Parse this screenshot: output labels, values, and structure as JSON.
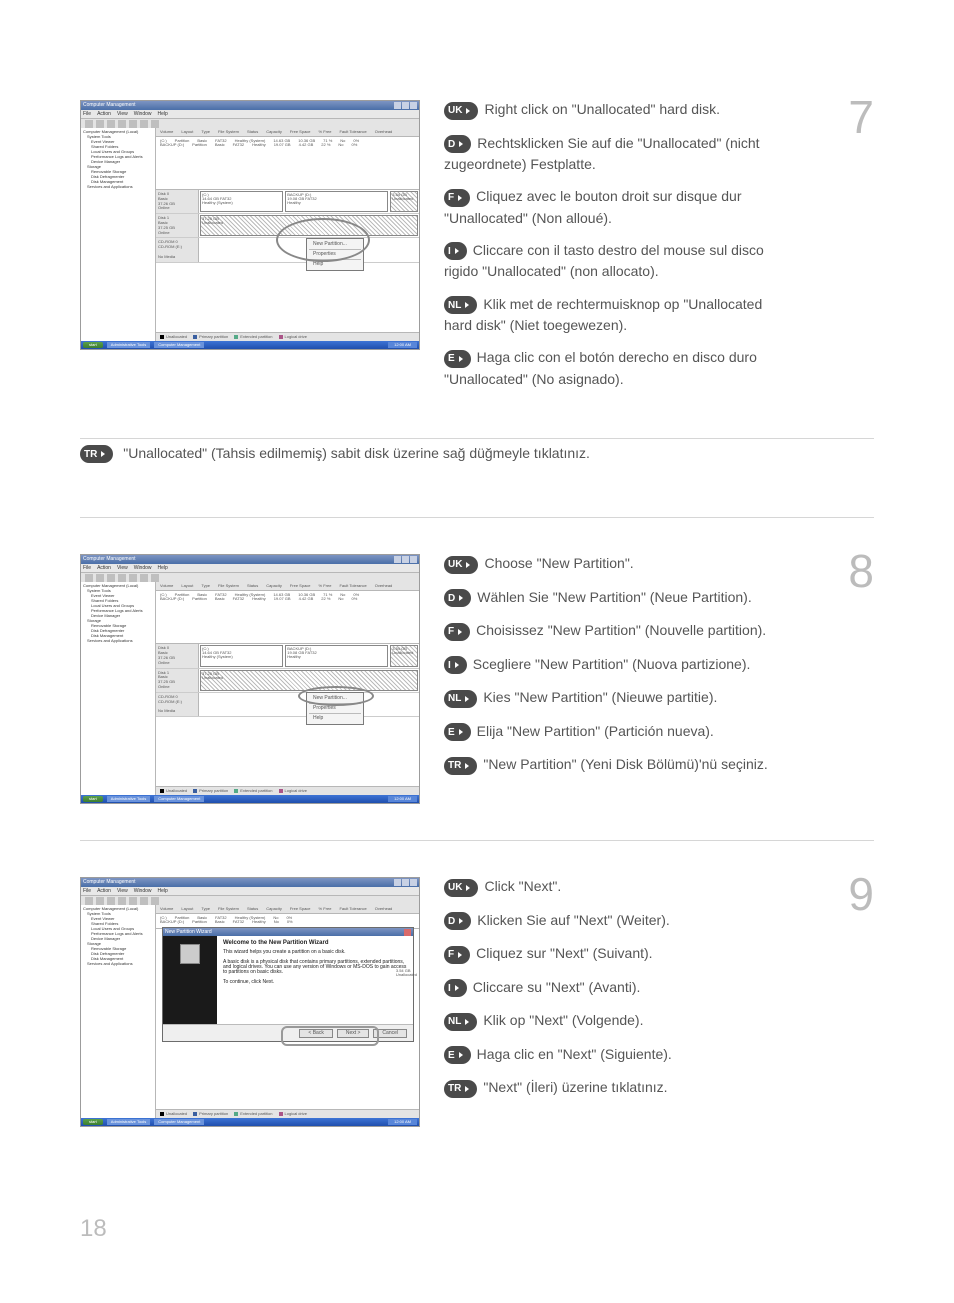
{
  "page_number": "18",
  "screenshot": {
    "window_title": "Computer Management",
    "menus": [
      "File",
      "Action",
      "View",
      "Window",
      "Help"
    ],
    "tree": [
      "Computer Management (Local)",
      "System Tools",
      "Event Viewer",
      "Shared Folders",
      "Local Users and Groups",
      "Performance Logs and Alerts",
      "Device Manager",
      "Storage",
      "Removable Storage",
      "Disk Defragmenter",
      "Disk Management",
      "Services and Applications"
    ],
    "columns": [
      "Volume",
      "Layout",
      "Type",
      "File System",
      "Status",
      "Capacity",
      "Free Space",
      "% Free",
      "Fault Tolerance",
      "Overhead"
    ],
    "rows": [
      [
        "(C:)",
        "Partition",
        "Basic",
        "FAT32",
        "Healthy (System)",
        "14.63 GB",
        "10.36 GB",
        "71 %",
        "No",
        "0%"
      ],
      [
        "BACKUP (D:)",
        "Partition",
        "Basic",
        "FAT32",
        "Healthy",
        "19.07 GB",
        "4.42 GB",
        "22 %",
        "No",
        "0%"
      ]
    ],
    "disks": {
      "disk0": {
        "label": "Disk 0",
        "sub": "Basic",
        "size": "37.26 GB",
        "state": "Online",
        "parts": [
          {
            "title": "(C:)",
            "info": "14.64 GB FAT32",
            "status": "Healthy (System)"
          },
          {
            "title": "BACKUP (D:)",
            "info": "19.08 GB FAT32",
            "status": "Healthy"
          },
          {
            "title": "",
            "info": "3.54 GB",
            "status": "Unallocated"
          }
        ]
      },
      "disk1": {
        "label": "Disk 1",
        "sub": "Basic",
        "size": "37.25 GB",
        "state": "Online",
        "parts": [
          {
            "title": "",
            "info": "37.25 GB",
            "status": "Unallocated"
          }
        ]
      },
      "cdrom": {
        "label": "CD-ROM 0",
        "sub": "CD-ROM (E:)",
        "state": "No Media"
      }
    },
    "legend": [
      "Unallocated",
      "Primary partition",
      "Extended partition",
      "Logical drive"
    ],
    "context_menu": [
      "New Partition...",
      "Properties",
      "Help"
    ],
    "wizard": {
      "title": "New Partition Wizard",
      "heading": "Welcome to the New Partition Wizard",
      "desc1": "This wizard helps you create a partition on a basic disk.",
      "desc2": "A basic disk is a physical disk that contains primary partitions, extended partitions, and logical drives. You can use any version of Windows or MS-DOS to gain access to partitions on basic disks.",
      "desc3": "To continue, click Next.",
      "buttons": {
        "back": "< Back",
        "next": "Next >",
        "cancel": "Cancel"
      }
    },
    "taskbar": {
      "start": "start",
      "items": [
        "Administrative Tools",
        "Computer Management"
      ],
      "time": "12:00 AM"
    }
  },
  "steps": [
    {
      "num": "7",
      "lines": [
        {
          "lang": "UK",
          "text": "Right click on \"Unallocated\" hard disk."
        },
        {
          "lang": "D",
          "text": "Rechtsklicken Sie auf die \"Unallocated\" (nicht",
          "cont": "zugeordnete) Festplatte."
        },
        {
          "lang": "F",
          "text": "Cliquez avec le bouton droit sur disque dur",
          "cont": "\"Unallocated\" (Non alloué)."
        },
        {
          "lang": "I",
          "text": "Cliccare con il tasto destro del mouse sul disco",
          "cont": "rigido \"Unallocated\" (non allocato)."
        },
        {
          "lang": "NL",
          "text": "Klik met de rechtermuisknop op \"Unallocated",
          "cont": "hard disk\" (Niet toegewezen)."
        },
        {
          "lang": "E",
          "text": "Haga clic con el botón derecho en disco duro",
          "cont": "\"Unallocated\" (No asignado)."
        }
      ],
      "tr": {
        "lang": "TR",
        "text": "\"Unallocated\" (Tahsis edilmemiş) sabit disk üzerine sağ düğmeyle tıklatınız."
      }
    },
    {
      "num": "8",
      "lines": [
        {
          "lang": "UK",
          "text": "Choose \"New Partition\"."
        },
        {
          "lang": "D",
          "text": "Wählen Sie \"New Partition\" (Neue Partition)."
        },
        {
          "lang": "F",
          "text": "Choisissez \"New Partition\" (Nouvelle partition)."
        },
        {
          "lang": "I",
          "text": "Scegliere \"New Partition\" (Nuova partizione)."
        },
        {
          "lang": "NL",
          "text": "Kies \"New Partition\" (Nieuwe partitie)."
        },
        {
          "lang": "E",
          "text": "Elija \"New Partition\" (Partición nueva)."
        },
        {
          "lang": "TR",
          "text": "\"New Partition\" (Yeni Disk Bölümü)'nü seçiniz."
        }
      ]
    },
    {
      "num": "9",
      "lines": [
        {
          "lang": "UK",
          "text": "Click \"Next\"."
        },
        {
          "lang": "D",
          "text": "Klicken Sie auf \"Next\" (Weiter)."
        },
        {
          "lang": "F",
          "text": "Cliquez sur \"Next\" (Suivant)."
        },
        {
          "lang": "I",
          "text": "Cliccare su \"Next\" (Avanti)."
        },
        {
          "lang": "NL",
          "text": "Klik op \"Next\" (Volgende)."
        },
        {
          "lang": "E",
          "text": "Haga clic en \"Next\" (Siguiente)."
        },
        {
          "lang": "TR",
          "text": "\"Next\" (İleri) üzerine tıklatınız."
        }
      ]
    }
  ]
}
